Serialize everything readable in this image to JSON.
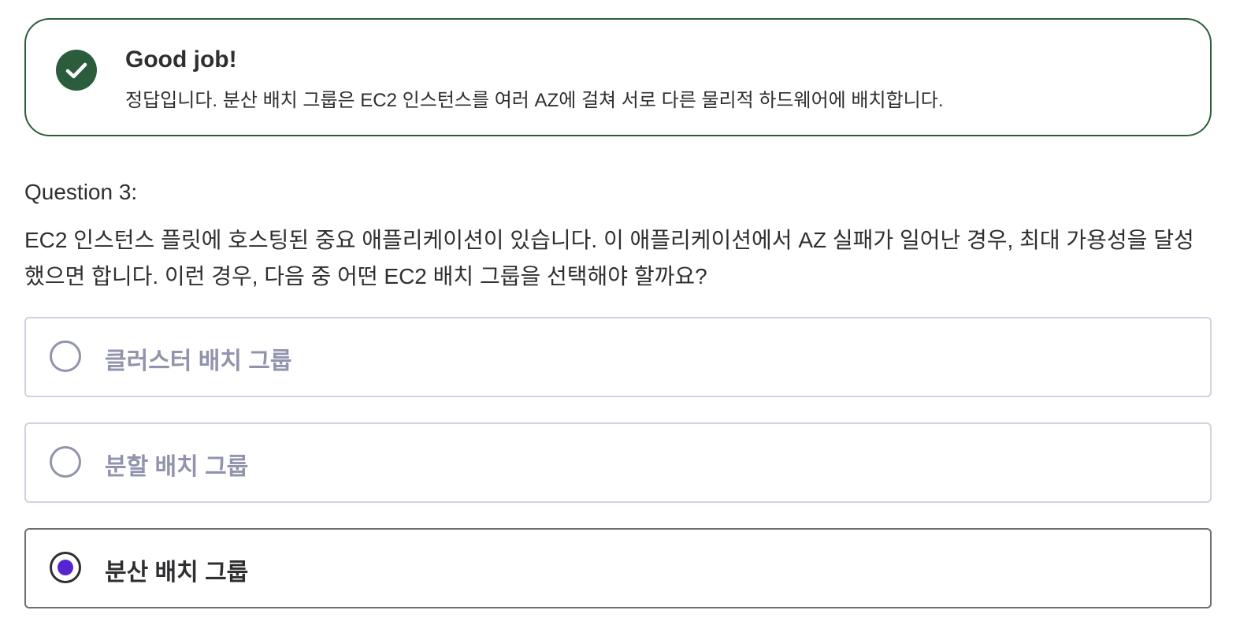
{
  "feedback": {
    "status_icon": "check-circle-icon",
    "title": "Good job!",
    "message": "정답입니다. 분산 배치 그룹은 EC2 인스턴스를 여러 AZ에 걸쳐 서로 다른 물리적 하드웨어에 배치합니다.",
    "color": "#2b5d3c"
  },
  "question": {
    "label": "Question 3:",
    "text": "EC2 인스턴스 플릿에 호스팅된 중요 애플리케이션이 있습니다. 이 애플리케이션에서 AZ 실패가 일어난 경우, 최대 가용성을 달성했으면 합니다. 이런 경우, 다음 중 어떤 EC2 배치 그룹을 선택해야 할까요?"
  },
  "options": [
    {
      "label": "클러스터 배치 그룹",
      "selected": false
    },
    {
      "label": "분할 배치 그룹",
      "selected": false
    },
    {
      "label": "분산 배치 그룹",
      "selected": true
    }
  ],
  "colors": {
    "accent": "#5624d0",
    "text": "#2d2f31",
    "muted": "#9194ac"
  }
}
